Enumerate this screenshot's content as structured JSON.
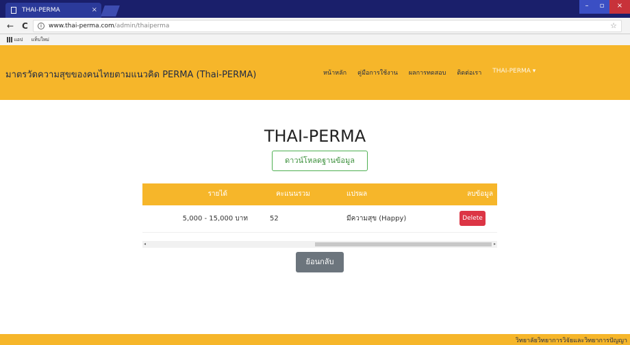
{
  "browser": {
    "tab_title": "THAI-PERMA",
    "tab_close": "×",
    "url_domain": "www.thai-perma.com",
    "url_path": "/admin/thaiperma",
    "back_glyph": "←",
    "reload_glyph": "C",
    "info_glyph": "i",
    "star_glyph": "☆",
    "bookmark_apps": "แอป",
    "bookmark_new": "แท็บใหม่",
    "win_min": "–",
    "win_max": "▫",
    "win_close": "×"
  },
  "navbar": {
    "brand": "มาตรวัดความสุขของคนไทยตามแนวคิด PERMA (Thai-PERMA)",
    "links": [
      "หน้าหลัก",
      "คู่มือการใช้งาน",
      "ผลการทดสอบ",
      "ติดต่อเรา"
    ],
    "dropdown": "THAI-PERMA ▾"
  },
  "main": {
    "title": "THAI-PERMA",
    "download_label": "ดาวน์โหลดฐานข้อมูล",
    "back_label": "ย้อนกลับ"
  },
  "table": {
    "headers": [
      "รายได้",
      "คะแนนรวม",
      "แปรผล",
      "ลบข้อมูล"
    ],
    "rows": [
      {
        "income": "5,000 - 15,000 บาท",
        "score": "52",
        "result": "มีความสุข (Happy)",
        "action": "Delete"
      }
    ]
  },
  "scroll": {
    "left_arrow": "◂",
    "right_arrow": "▸"
  },
  "footer": {
    "text": "วิทยาลัยวิทยาการวิจัยและวิทยาการปัญญา"
  },
  "colors": {
    "accent": "#f6b62a",
    "danger": "#dc3545",
    "success": "#4caf50",
    "secondary": "#6c757d"
  }
}
